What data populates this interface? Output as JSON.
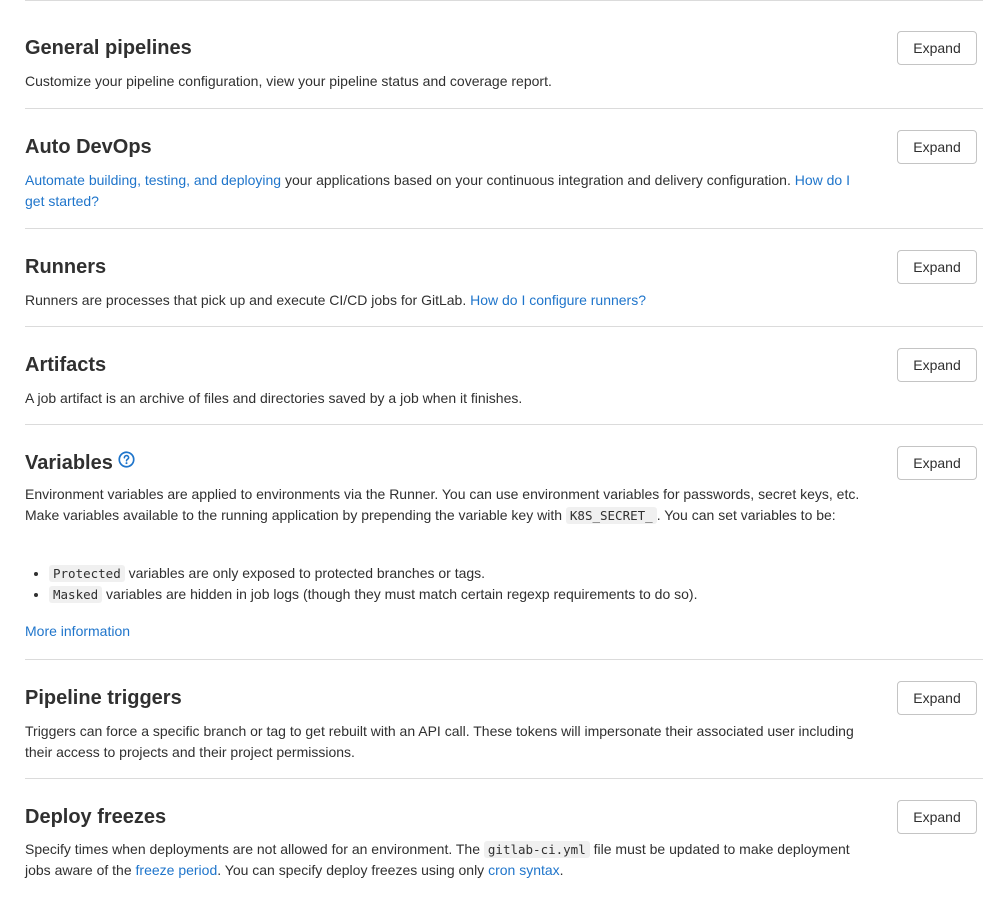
{
  "sections": {
    "general": {
      "title": "General pipelines",
      "desc": "Customize your pipeline configuration, view your pipeline status and coverage report.",
      "expand": "Expand"
    },
    "autodevops": {
      "title": "Auto DevOps",
      "link1": "Automate building, testing, and deploying",
      "text1": " your applications based on your continuous integration and delivery configuration. ",
      "link2": "How do I get started?",
      "expand": "Expand"
    },
    "runners": {
      "title": "Runners",
      "text1": "Runners are processes that pick up and execute CI/CD jobs for GitLab. ",
      "link1": "How do I configure runners?",
      "expand": "Expand"
    },
    "artifacts": {
      "title": "Artifacts",
      "desc": "A job artifact is an archive of files and directories saved by a job when it finishes.",
      "expand": "Expand"
    },
    "variables": {
      "title": "Variables",
      "text1": "Environment variables are applied to environments via the Runner. You can use environment variables for passwords, secret keys, etc. Make variables available to the running application by prepending the variable key with ",
      "code1": "K8S_SECRET_",
      "text2": ". You can set variables to be:",
      "bullets": [
        {
          "code": "Protected",
          "text": " variables are only exposed to protected branches or tags."
        },
        {
          "code": "Masked",
          "text": " variables are hidden in job logs (though they must match certain regexp requirements to do so)."
        }
      ],
      "more": "More information",
      "expand": "Expand"
    },
    "triggers": {
      "title": "Pipeline triggers",
      "desc": "Triggers can force a specific branch or tag to get rebuilt with an API call. These tokens will impersonate their associated user including their access to projects and their project permissions.",
      "expand": "Expand"
    },
    "freezes": {
      "title": "Deploy freezes",
      "text1": "Specify times when deployments are not allowed for an environment. The ",
      "code1": "gitlab-ci.yml",
      "text2": " file must be updated to make deployment jobs aware of the ",
      "link1": "freeze period",
      "text3": ". You can specify deploy freezes using only ",
      "link2": "cron syntax",
      "text4": ".",
      "expand": "Expand"
    }
  },
  "colors": {
    "link": "#1f75cb",
    "text": "#303030",
    "border": "#dbdbdb"
  }
}
